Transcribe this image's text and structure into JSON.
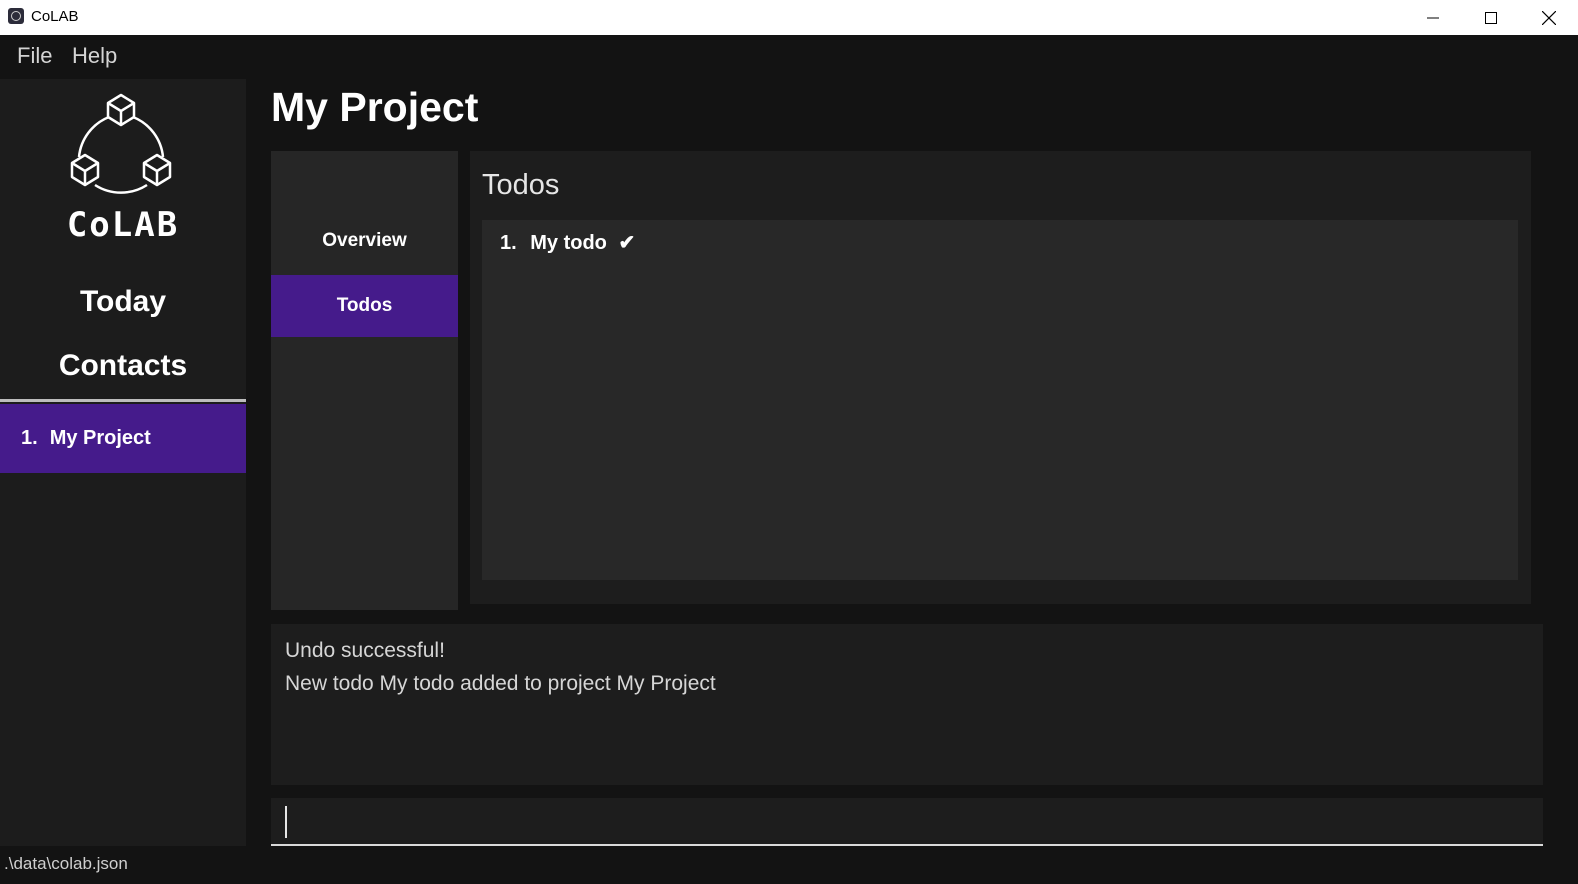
{
  "window": {
    "title": "CoLAB"
  },
  "menu": {
    "items": [
      {
        "label": "File"
      },
      {
        "label": "Help"
      }
    ]
  },
  "sidebar": {
    "logo_text": "CoLAB",
    "nav": {
      "today": "Today",
      "contacts": "Contacts"
    },
    "projects": [
      {
        "index": "1.",
        "name": "My Project",
        "selected": true
      }
    ]
  },
  "main": {
    "title": "My Project",
    "tabs": [
      {
        "label": "Overview",
        "active": false
      },
      {
        "label": "Todos",
        "active": true
      }
    ],
    "todos": {
      "heading": "Todos",
      "items": [
        {
          "index": "1.",
          "description": "My todo",
          "done_mark": "✔",
          "completed": true
        }
      ]
    }
  },
  "result": {
    "lines": [
      "Undo successful!",
      "New todo My todo added to project My Project"
    ]
  },
  "command": {
    "value": "",
    "placeholder": ""
  },
  "status": {
    "file_path": ".\\data\\colab.json"
  },
  "colors": {
    "accent": "#451b8b",
    "background": "#131313",
    "sidebar": "#1c1c1c",
    "panel": "#262626"
  },
  "icons": {
    "app": "colab-app-icon",
    "logo": "colab-logo-cubes",
    "minimize": "minimize-icon",
    "maximize": "maximize-icon",
    "close": "close-icon"
  }
}
